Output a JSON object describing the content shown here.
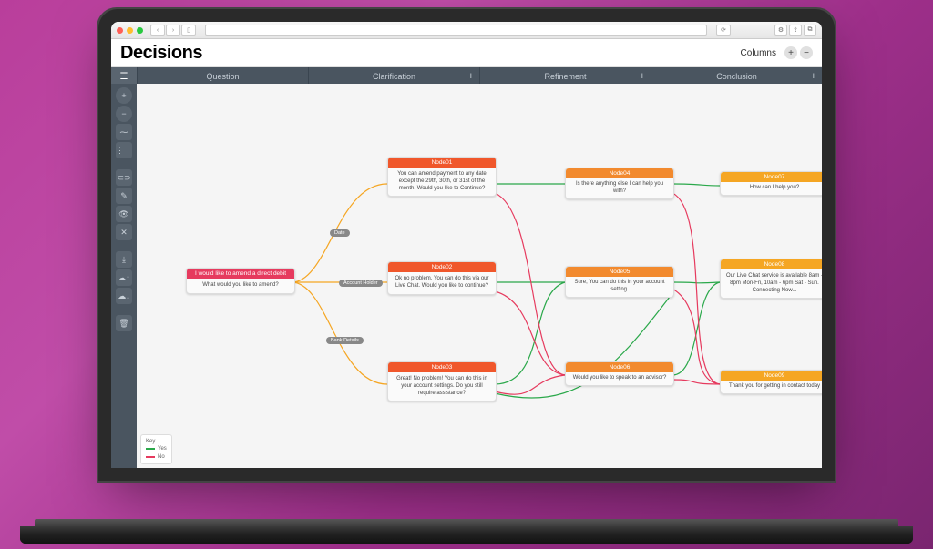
{
  "app": {
    "title": "Decisions"
  },
  "toolbar": {
    "columns_label": "Columns",
    "add_label": "+",
    "remove_label": "−"
  },
  "columns": [
    {
      "label": "Question",
      "has_add": false
    },
    {
      "label": "Clarification",
      "has_add": true
    },
    {
      "label": "Refinement",
      "has_add": true
    },
    {
      "label": "Conclusion",
      "has_add": true
    }
  ],
  "sidebar_tools": [
    {
      "name": "add",
      "glyph": "+"
    },
    {
      "name": "remove",
      "glyph": "−"
    },
    {
      "name": "line",
      "glyph": "⁓"
    },
    {
      "name": "grid",
      "glyph": "⋮⋮"
    },
    {
      "name": "link",
      "glyph": "⊂⊃"
    },
    {
      "name": "edit",
      "glyph": "✎"
    },
    {
      "name": "visibility",
      "glyph": "👁"
    },
    {
      "name": "close",
      "glyph": "✕"
    },
    {
      "name": "download",
      "glyph": "⤓"
    },
    {
      "name": "upload",
      "glyph": "☁↑"
    },
    {
      "name": "save-cloud",
      "glyph": "☁↓"
    },
    {
      "name": "trash",
      "glyph": "🗑"
    }
  ],
  "nodes": {
    "start": {
      "title": "I would like to amend a direct debit",
      "body": "What would you like to amend?"
    },
    "n1": {
      "title": "Node01",
      "body": "You can amend payment to any date except the 29th, 30th, or 31st of the month.\nWould you like to Continue?"
    },
    "n2": {
      "title": "Node02",
      "body": "Ok no problem. You can do this via our Live Chat.\nWould you like to continue?"
    },
    "n3": {
      "title": "Node03",
      "body": "Great! No problem! You can do this in your account settings.\nDo you still require assistance?"
    },
    "n4": {
      "title": "Node04",
      "body": "Is there anything else I can help you with?"
    },
    "n5": {
      "title": "Node05",
      "body": "Sure, You can do this in your account setting."
    },
    "n6": {
      "title": "Node06",
      "body": "Would you like to speak to an advisor?"
    },
    "n7": {
      "title": "Node07",
      "body": "How can I help you?"
    },
    "n8": {
      "title": "Node08",
      "body": "Our Live Chat service is available 8am - 8pm Mon-Fri, 10am - 6pm Sat - Sun.\nConnecting Now..."
    },
    "n9": {
      "title": "Node09",
      "body": "Thank you for getting in contact today"
    }
  },
  "edge_labels": {
    "date": "Date",
    "account_holder": "Account Holder",
    "bank_details": "Bank Details"
  },
  "key": {
    "title": "Key",
    "yes": "Yes",
    "no": "No"
  },
  "colors": {
    "yes": "#2aa84a",
    "no": "#e63a5e"
  }
}
